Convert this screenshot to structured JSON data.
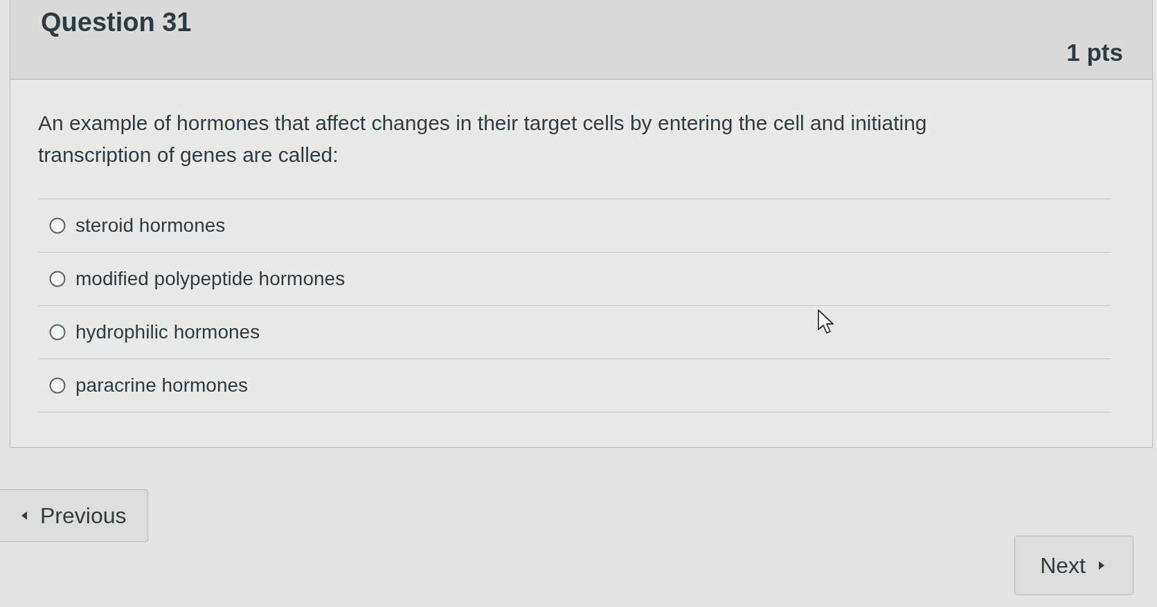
{
  "question": {
    "title": "Question 31",
    "points": "1 pts",
    "text": "An example of hormones that affect changes in their target cells by entering the cell and initiating transcription of genes are called:",
    "answers": [
      {
        "label": "steroid hormones",
        "selected": false
      },
      {
        "label": "modified polypeptide hormones",
        "selected": false
      },
      {
        "label": "hydrophilic hormones",
        "selected": false
      },
      {
        "label": "paracrine hormones",
        "selected": false
      }
    ]
  },
  "navigation": {
    "previous": "Previous",
    "next": "Next"
  }
}
